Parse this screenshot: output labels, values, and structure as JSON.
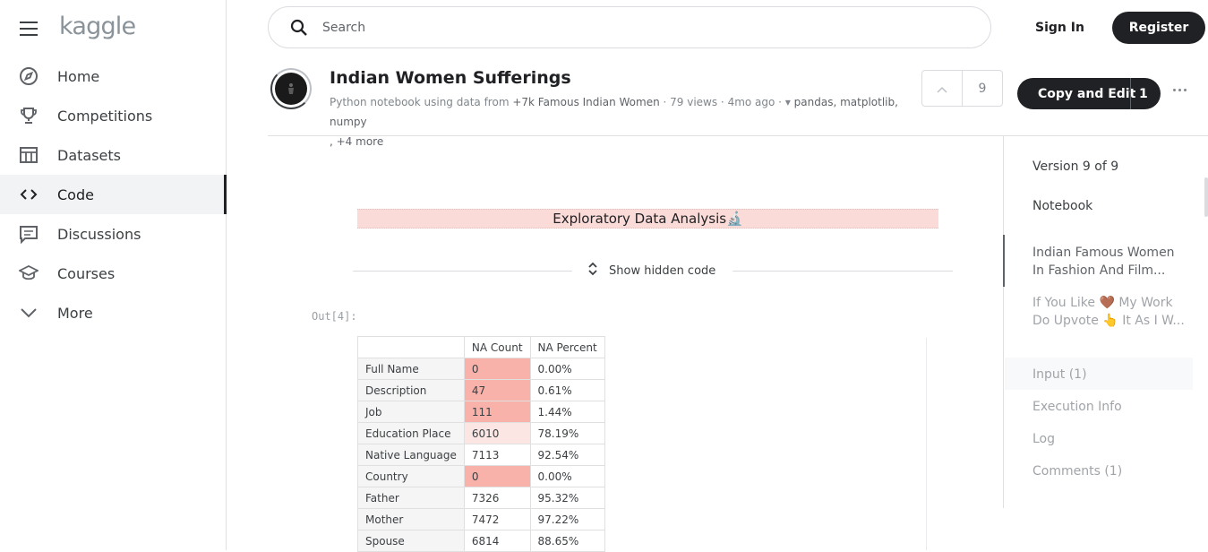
{
  "sidebar": {
    "logo": "kaggle",
    "items": [
      {
        "label": "Home",
        "icon": "compass-icon"
      },
      {
        "label": "Competitions",
        "icon": "trophy-icon"
      },
      {
        "label": "Datasets",
        "icon": "table-icon"
      },
      {
        "label": "Code",
        "icon": "code-icon",
        "active": true
      },
      {
        "label": "Discussions",
        "icon": "comments-icon"
      },
      {
        "label": "Courses",
        "icon": "school-icon"
      },
      {
        "label": "More",
        "icon": "chevron-down-icon"
      }
    ]
  },
  "topbar": {
    "search_placeholder": "Search",
    "signin_label": "Sign In",
    "register_label": "Register"
  },
  "notebook": {
    "title": "Indian Women Sufferings",
    "meta_prefix": "Python notebook using data from ",
    "dataset_link": "+7k Famous Indian Women",
    "views": " · 79 views · ",
    "age": "4mo ago",
    "age_sep": " · ",
    "tags": "pandas, matplotlib, numpy",
    "more_tags": ", +4 more",
    "vote_count": "9",
    "copy_edit_label": "Copy and Edit",
    "copy_edit_count": "1"
  },
  "right_panel": {
    "version": "Version 9 of 9",
    "notebook": "Notebook",
    "toc_1_line1": "Indian Famous Women",
    "toc_1_line2": "In Fashion And Film...",
    "toc_2_line1": "If You Like 🤎 My Work",
    "toc_2_line2": "Do Upvote 👆 It As I W...",
    "input": "Input (1)",
    "execution": "Execution Info",
    "log": "Log",
    "comments": "Comments (1)"
  },
  "content": {
    "banner": "Exploratory Data Analysis🔬",
    "show_hidden": "Show hidden code",
    "out_label": "Out[4]:",
    "table": {
      "headers": [
        "",
        "NA Count",
        "NA Percent"
      ],
      "rows": [
        {
          "name": "Full Name",
          "count": "0",
          "percent": "0.00%",
          "color": "#f8b2aa"
        },
        {
          "name": "Description",
          "count": "47",
          "percent": "0.61%",
          "color": "#f8b2aa"
        },
        {
          "name": "Job",
          "count": "111",
          "percent": "1.44%",
          "color": "#f8b2aa"
        },
        {
          "name": "Education Place",
          "count": "6010",
          "percent": "78.19%",
          "color": "#fbe6e3"
        },
        {
          "name": "Native Language",
          "count": "7113",
          "percent": "92.54%",
          "color": "#ffffff"
        },
        {
          "name": "Country",
          "count": "0",
          "percent": "0.00%",
          "color": "#f8b2aa"
        },
        {
          "name": "Father",
          "count": "7326",
          "percent": "95.32%",
          "color": "#ffffff"
        },
        {
          "name": "Mother",
          "count": "7472",
          "percent": "97.22%",
          "color": "#ffffff"
        },
        {
          "name": "Spouse",
          "count": "6814",
          "percent": "88.65%",
          "color": "#ffffff"
        }
      ]
    }
  }
}
